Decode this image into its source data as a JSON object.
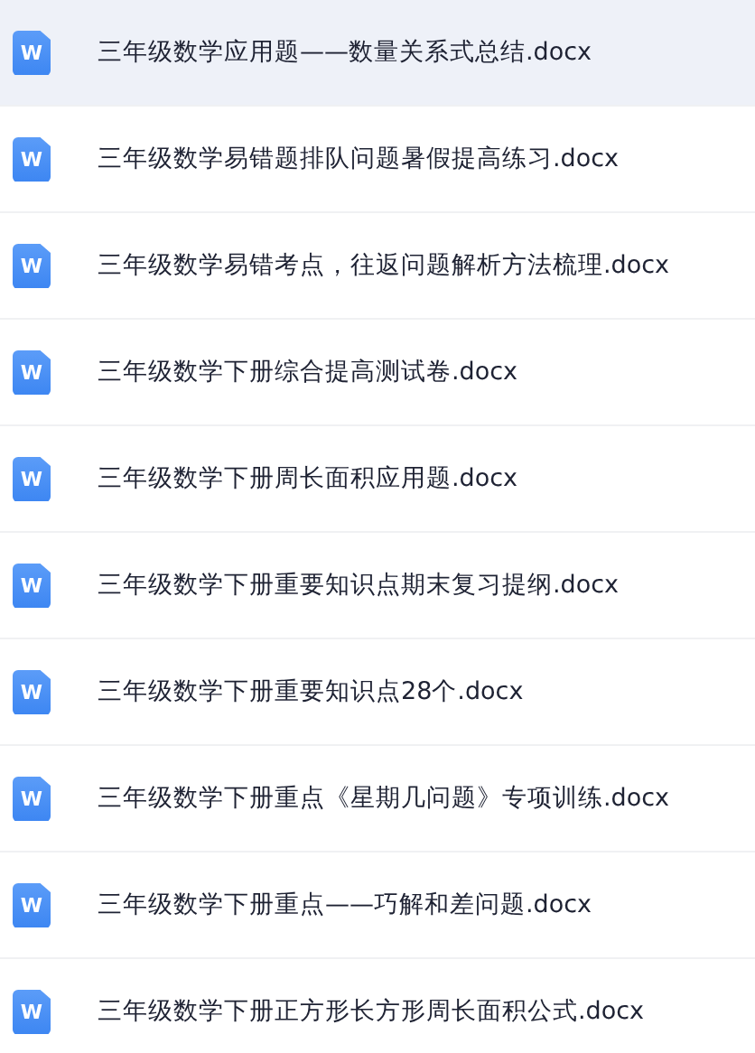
{
  "files": [
    {
      "name": "三年级数学应用题——数量关系式总结.docx",
      "icon_letter": "W",
      "selected": true
    },
    {
      "name": "三年级数学易错题排队问题暑假提高练习.docx",
      "icon_letter": "W",
      "selected": false
    },
    {
      "name": "三年级数学易错考点，往返问题解析方法梳理.docx",
      "icon_letter": "W",
      "selected": false
    },
    {
      "name": "三年级数学下册综合提高测试卷.docx",
      "icon_letter": "W",
      "selected": false
    },
    {
      "name": "三年级数学下册周长面积应用题.docx",
      "icon_letter": "W",
      "selected": false
    },
    {
      "name": "三年级数学下册重要知识点期末复习提纲.docx",
      "icon_letter": "W",
      "selected": false
    },
    {
      "name": "三年级数学下册重要知识点28个.docx",
      "icon_letter": "W",
      "selected": false
    },
    {
      "name": "三年级数学下册重点《星期几问题》专项训练.docx",
      "icon_letter": "W",
      "selected": false
    },
    {
      "name": "三年级数学下册重点——巧解和差问题.docx",
      "icon_letter": "W",
      "selected": false
    },
    {
      "name": "三年级数学下册正方形长方形周长面积公式.docx",
      "icon_letter": "W",
      "selected": false
    }
  ]
}
